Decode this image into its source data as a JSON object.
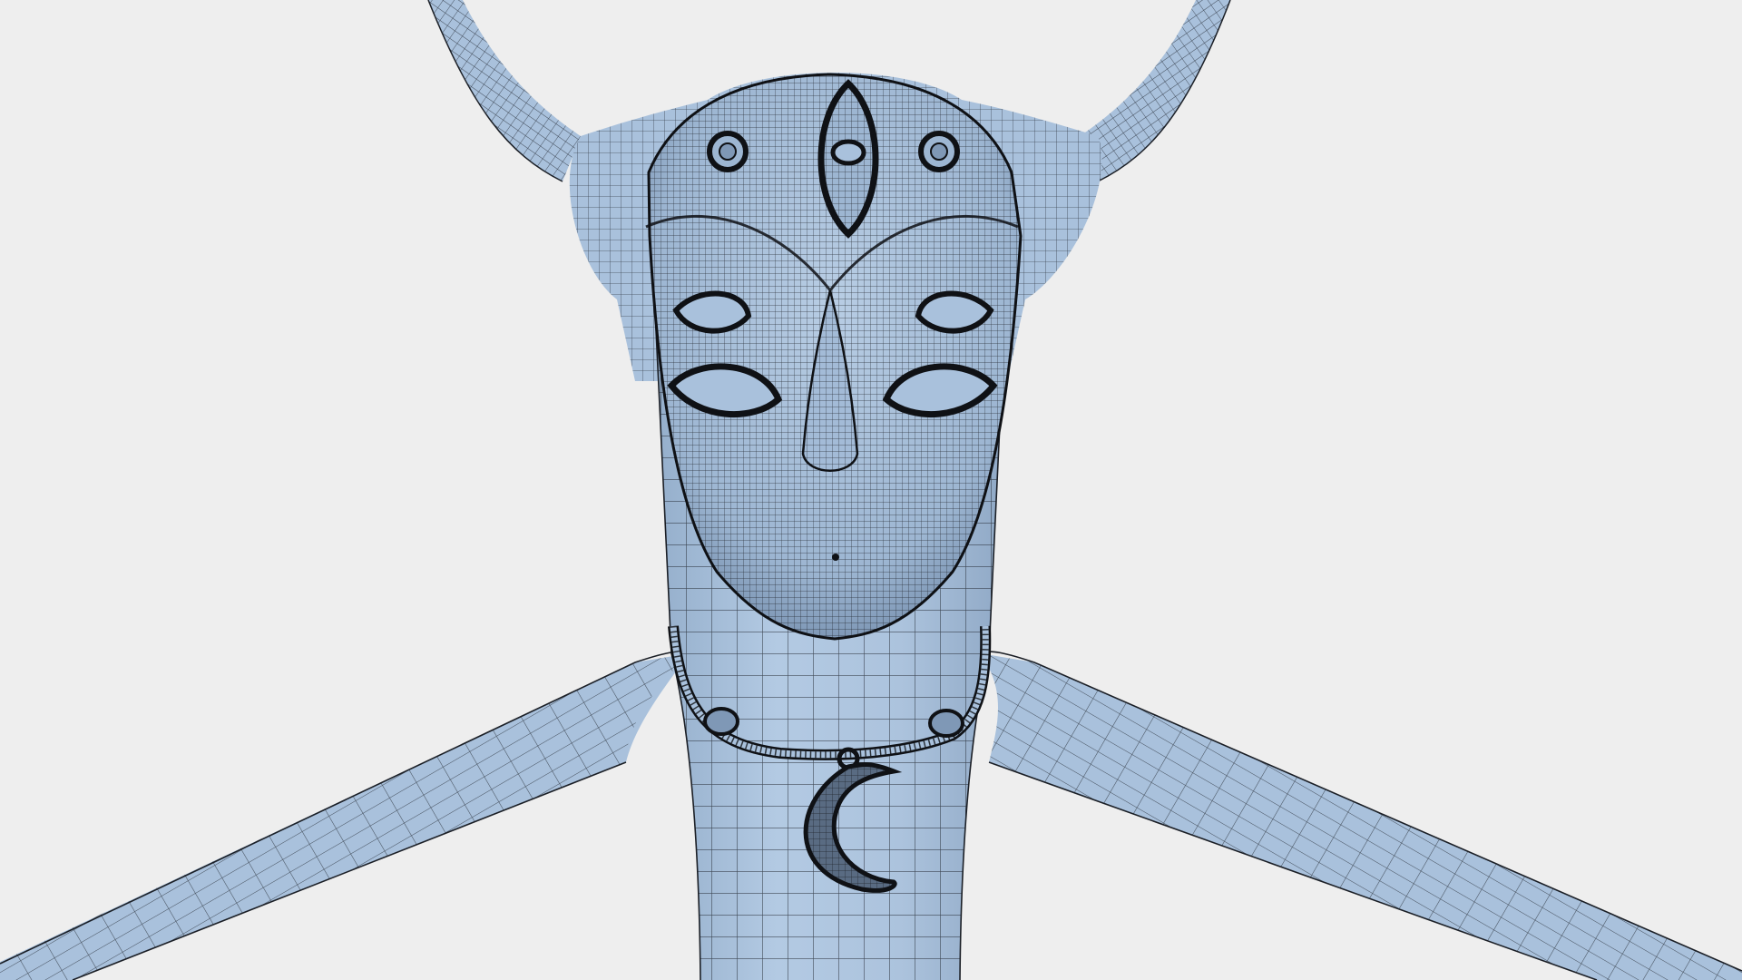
{
  "scene": {
    "background_color": "#eeeeee",
    "mesh_fill_color": "#a9c1dc",
    "mesh_shade_color": "#8fa9c7",
    "wire_color": "#1b1f26",
    "dense_wire_color": "#0f1115",
    "subject": "wireframe-figure-with-mask-and-moon-pendant"
  }
}
